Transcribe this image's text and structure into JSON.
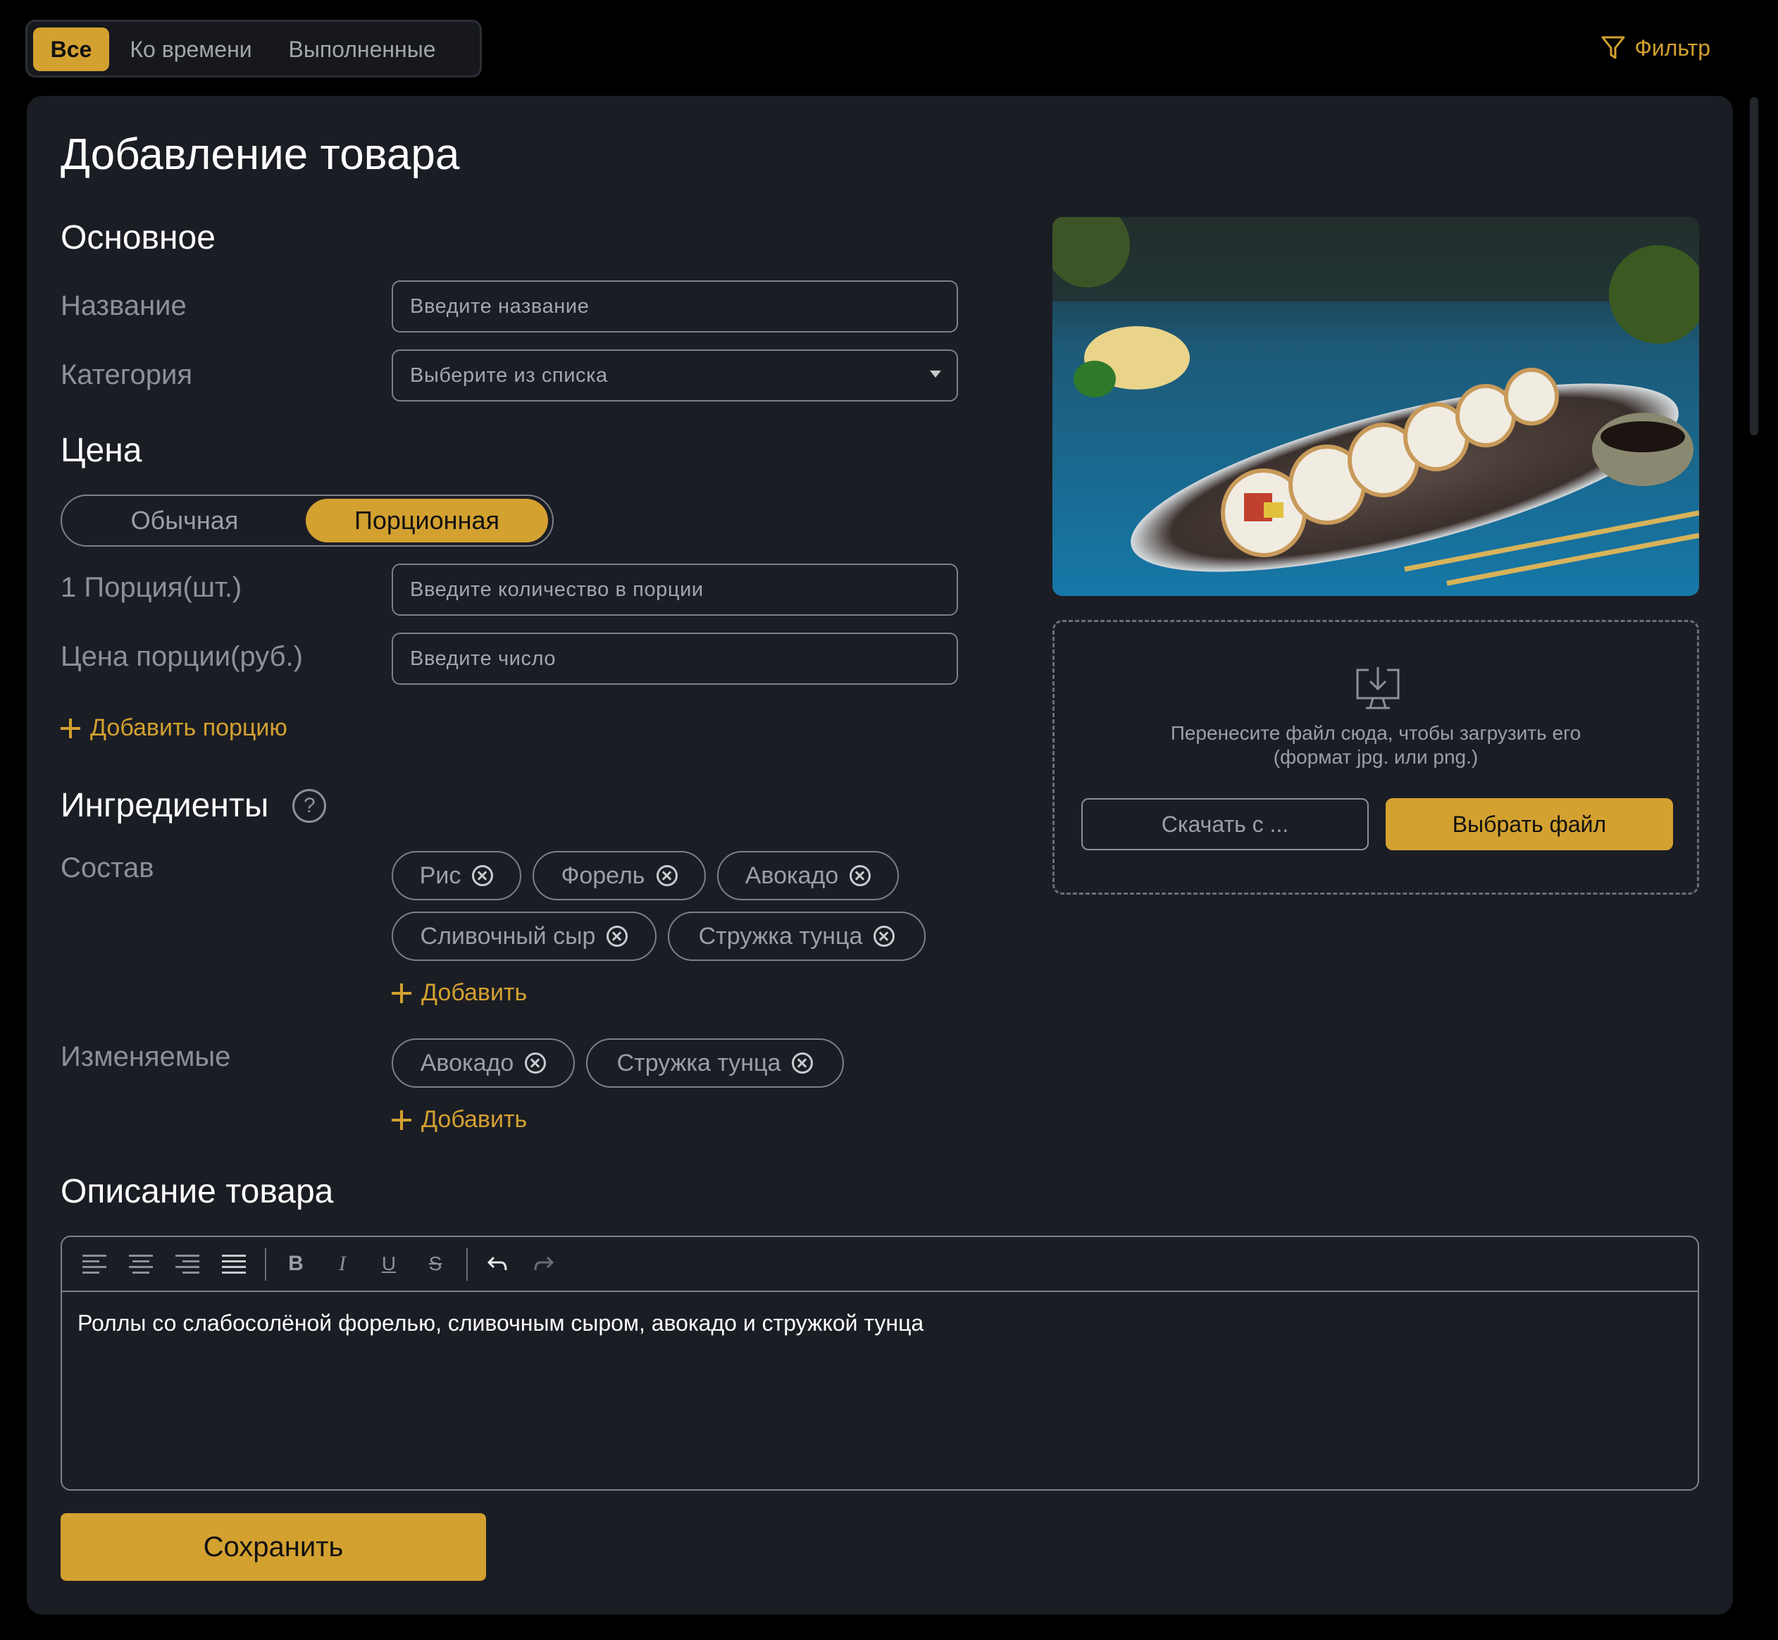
{
  "tabs": [
    {
      "label": "Все",
      "active": true
    },
    {
      "label": "Ко времени",
      "active": false
    },
    {
      "label": "Выполненные",
      "active": false
    }
  ],
  "filter": {
    "label": "Фильтр",
    "icon": "filter-icon"
  },
  "page_title": "Добавление товара",
  "basic": {
    "heading": "Основное",
    "name_label": "Название",
    "name_placeholder": "Введите название",
    "category_label": "Категория",
    "category_placeholder": "Выберите из списка"
  },
  "price": {
    "heading": "Цена",
    "options": [
      "Обычная",
      "Порционная"
    ],
    "selected": "Порционная",
    "portion_label": "1 Порция(шт.)",
    "portion_placeholder": "Введите количество в порции",
    "portion_price_label": "Цена порции(руб.)",
    "portion_price_placeholder": "Введите число",
    "add_portion": "Добавить порцию"
  },
  "ingredients": {
    "heading": "Ингредиенты",
    "help_icon": "?",
    "composition_label": "Состав",
    "composition": [
      "Рис",
      "Форель",
      "Авокадо",
      "Сливочный сыр",
      "Стружка тунца"
    ],
    "add_label": "Добавить",
    "changeable_label": "Изменяемые",
    "changeable": [
      "Авокадо",
      "Стружка тунца"
    ]
  },
  "upload": {
    "hint_line1": "Перенесите файл сюда, чтобы загрузить его",
    "hint_line2": "(формат jpg. или png.)",
    "download_label": "Скачать с ...",
    "choose_label": "Выбрать файл"
  },
  "description": {
    "heading": "Описание товара",
    "text": "Роллы со слабосолёной форелью, сливочным сыром, авокадо и стружкой тунца",
    "toolbar_icons": [
      "align-left-icon",
      "align-center-icon",
      "align-right-icon",
      "align-justify-icon",
      "bold-icon",
      "italic-icon",
      "underline-icon",
      "strikethrough-icon",
      "undo-icon",
      "redo-icon"
    ]
  },
  "save_label": "Сохранить",
  "colors": {
    "accent": "#d3a130",
    "card": "#1b1d24",
    "background": "#000000",
    "muted": "#8e9097"
  }
}
